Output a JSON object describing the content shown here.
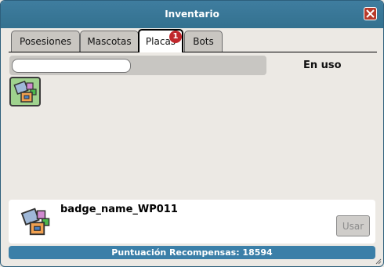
{
  "window": {
    "title": "Inventario"
  },
  "tabs": [
    {
      "label": "Posesiones"
    },
    {
      "label": "Mascotas"
    },
    {
      "label": "Placas",
      "badge": "1",
      "active": true
    },
    {
      "label": "Bots"
    }
  ],
  "filter": {
    "search_value": "",
    "in_use_label": "En uso"
  },
  "items": [
    {
      "icon": "badge-icon"
    }
  ],
  "selected": {
    "name": "badge_name_WP011",
    "use_label": "Usar",
    "icon": "badge-icon"
  },
  "footer": {
    "points_text": "Puntuación Recompensas: 18594"
  },
  "colors": {
    "titlebar": "#3a7898",
    "tab_active": "#ffffff",
    "notification": "#c0282d",
    "item_bg": "#9fd28e",
    "points_bar": "#3b7fa8"
  }
}
